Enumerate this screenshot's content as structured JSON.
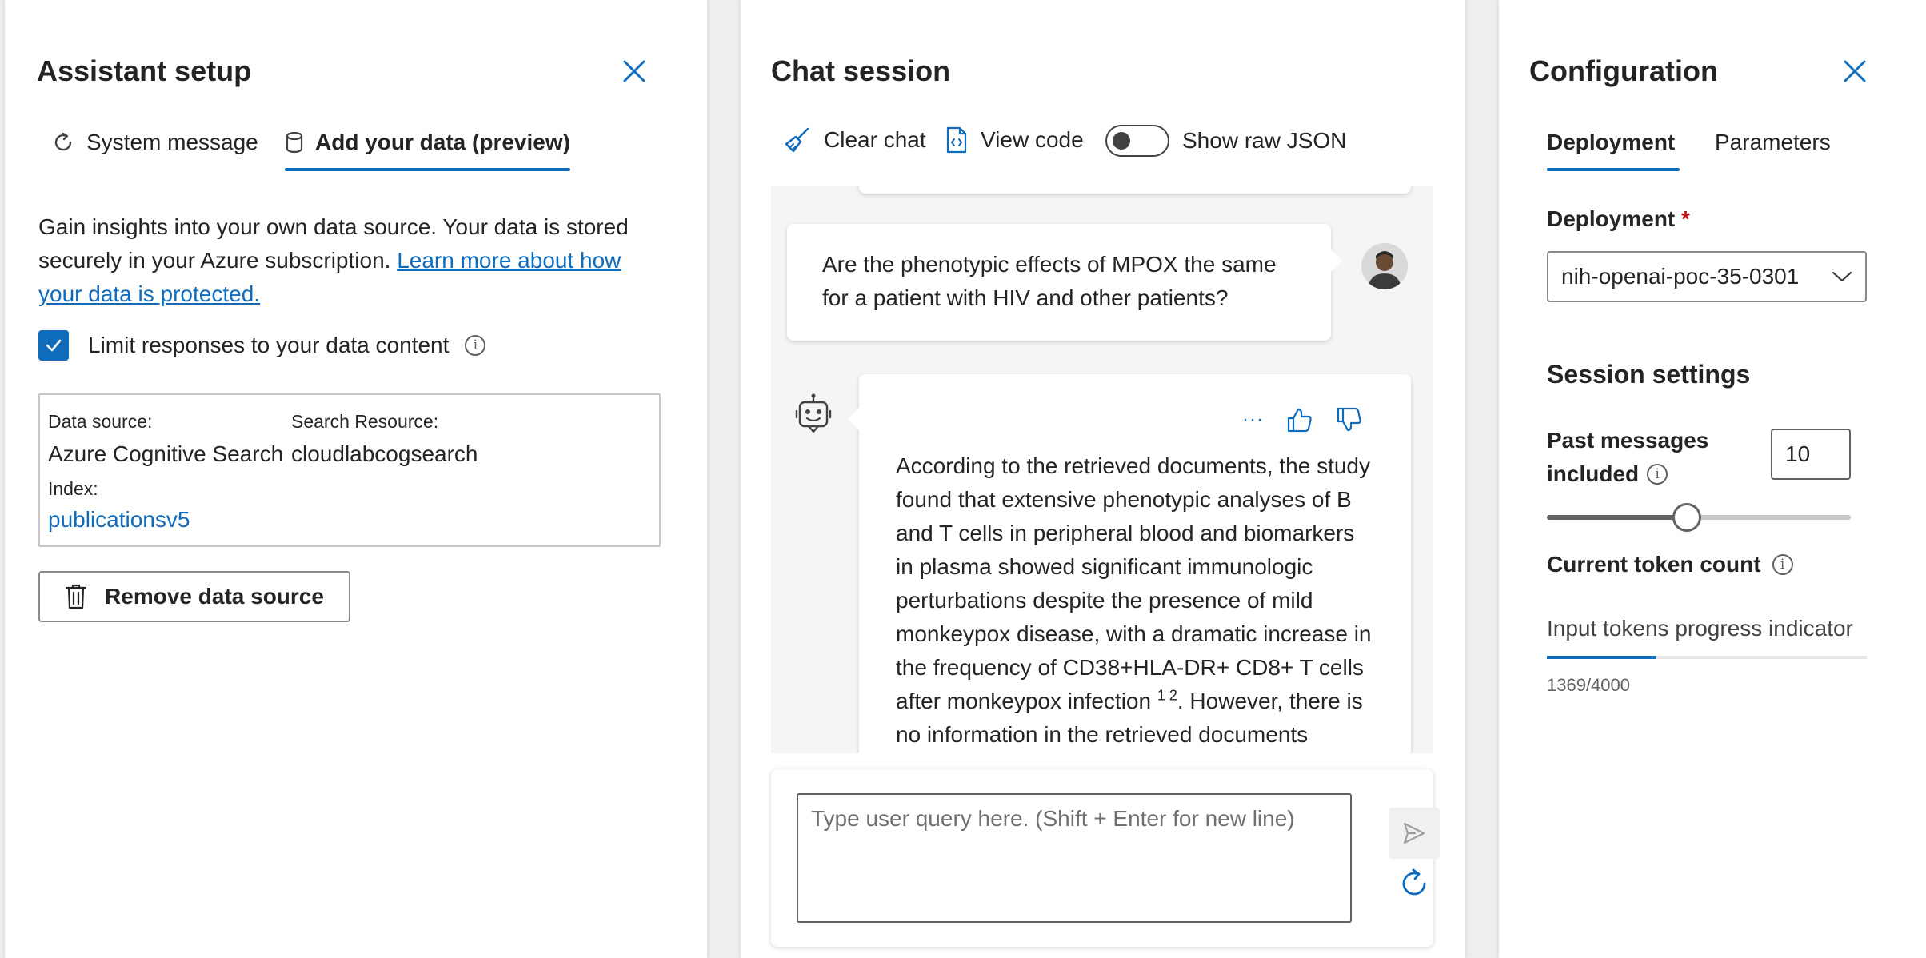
{
  "assistant_setup": {
    "title": "Assistant setup",
    "tabs": [
      {
        "label": "System message",
        "icon": "refresh-icon",
        "active": false
      },
      {
        "label": "Add your data (preview)",
        "icon": "database-icon",
        "active": true
      }
    ],
    "intro_text": "Gain insights into your own data source. Your data is stored securely in your Azure subscription.",
    "learn_more_link": "Learn more about how your data is protected.",
    "limit_checkbox_label": "Limit responses to your data content",
    "limit_checked": true,
    "data_source_label": "Data source:",
    "data_source_value": "Azure Cognitive Search",
    "search_resource_label": "Search Resource:",
    "search_resource_value": "cloudlabcogsearch",
    "index_label": "Index:",
    "index_value": "publicationsv5",
    "remove_button": "Remove data source"
  },
  "chat_session": {
    "title": "Chat session",
    "clear_chat": "Clear chat",
    "view_code": "View code",
    "show_raw_json": "Show raw JSON",
    "raw_json_on": false,
    "user_message": "Are the phenotypic effects of MPOX the same for a patient with HIV and other patients?",
    "assistant_message_part1": "According to the retrieved documents, the study found that extensive phenotypic analyses of B and T cells in peripheral blood and biomarkers in plasma showed significant immunologic perturbations despite the presence of mild monkeypox disease, with a dramatic increase in the frequency of CD38+HLA-DR+ CD8+ T cells after monkeypox infection",
    "citations": "1 2",
    "assistant_message_part2": ". However, there is no information in the retrieved documents",
    "more_options": "···",
    "input_placeholder": "Type user query here. (Shift + Enter for new line)"
  },
  "configuration": {
    "title": "Configuration",
    "tabs": [
      {
        "label": "Deployment",
        "active": true
      },
      {
        "label": "Parameters",
        "active": false
      }
    ],
    "deployment_label": "Deployment",
    "required_marker": "*",
    "deployment_value": "nih-openai-poc-35-0301",
    "session_settings_title": "Session settings",
    "past_messages_label_line1": "Past messages",
    "past_messages_label_line2": "included",
    "past_messages_value": "10",
    "past_messages_slider_fraction": 0.46,
    "current_token_label": "Current token count",
    "input_tokens_label": "Input tokens progress indicator",
    "token_used": 1369,
    "token_max": 4000,
    "token_text": "1369/4000"
  },
  "colors": {
    "accent": "#0f6cbd",
    "required": "#c50f1f"
  }
}
